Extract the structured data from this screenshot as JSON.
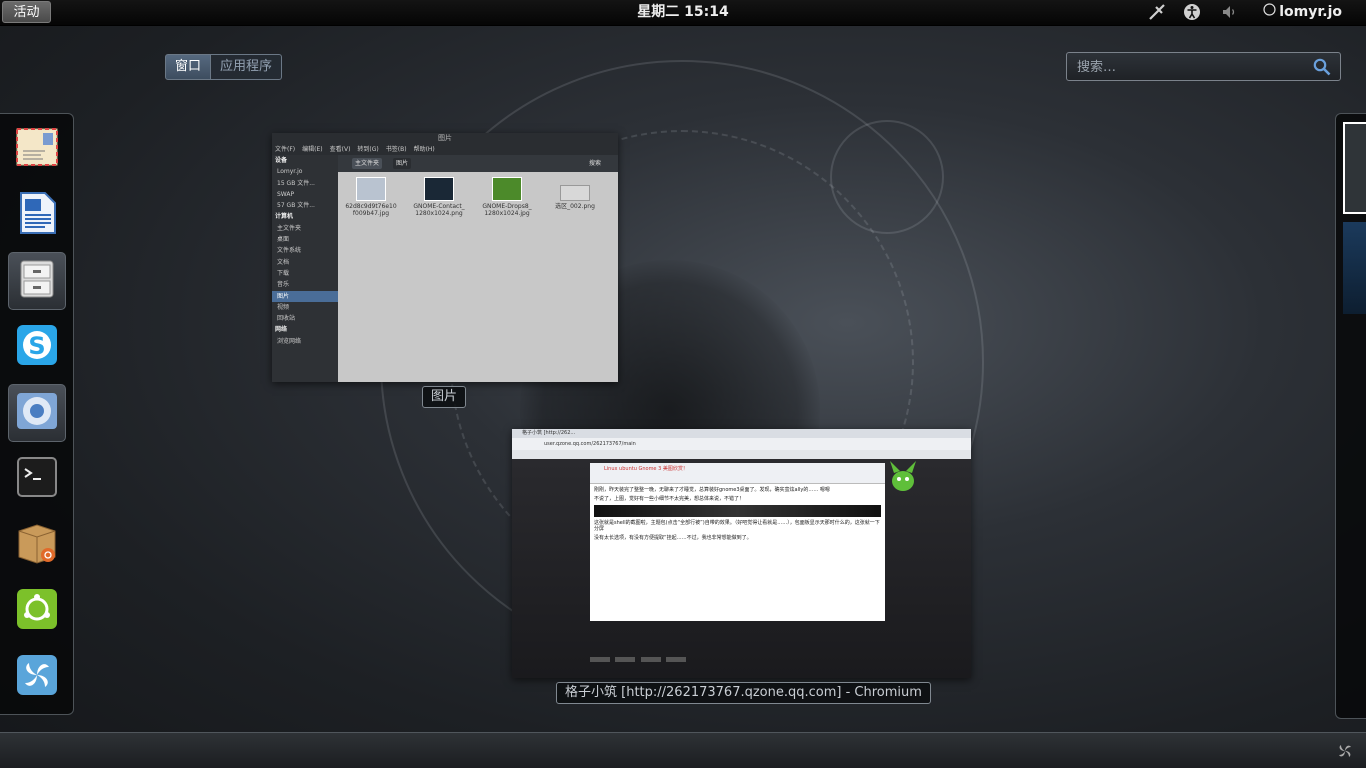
{
  "topbar": {
    "activities_label": "活动",
    "clock": "星期二 15:14",
    "user_name": "lomyr.jo"
  },
  "overview": {
    "view_tabs": [
      "窗口",
      "应用程序"
    ],
    "active_tab": "窗口",
    "search": {
      "placeholder": "搜索…",
      "value": ""
    }
  },
  "dash": {
    "apps": [
      {
        "name": "mail",
        "icon": "envelope-icon",
        "running": false
      },
      {
        "name": "writer",
        "icon": "document-icon",
        "running": false
      },
      {
        "name": "files",
        "icon": "file-cabinet-icon",
        "running": true
      },
      {
        "name": "skype",
        "icon": "skype-icon",
        "running": false
      },
      {
        "name": "chromium",
        "icon": "chromium-icon",
        "running": true
      },
      {
        "name": "terminal",
        "icon": "terminal-icon",
        "running": false
      },
      {
        "name": "package-installer",
        "icon": "package-icon",
        "running": false
      },
      {
        "name": "ubuntu-one",
        "icon": "ubuntu-icon",
        "running": false
      },
      {
        "name": "shotwell",
        "icon": "shotwell-icon",
        "running": false
      }
    ]
  },
  "windows": {
    "files": {
      "caption": "图片",
      "title": "图片",
      "menu": [
        "文件(F)",
        "编辑(E)",
        "查看(V)",
        "转到(G)",
        "书签(B)",
        "帮助(H)"
      ],
      "sidebar": {
        "devices_header": "设备",
        "devices": [
          "Lomyr.jo",
          "15 GB 文件...",
          "SWAP",
          "57 GB 文件..."
        ],
        "computer_header": "计算机",
        "places": [
          "主文件夹",
          "桌面",
          "文件系统",
          "文档",
          "下载",
          "音乐",
          "图片",
          "视频",
          "回收站"
        ],
        "network_header": "网络",
        "network": [
          "浏览网络"
        ]
      },
      "path": [
        "主文件夹",
        "图片"
      ],
      "search_label": "搜索",
      "files": [
        {
          "name": "62d8c9d9t76e10f009b47.jpg",
          "line1": "62d8c9d9t76e10",
          "line2": "f009b47.jpg",
          "color": "#b9c3d0"
        },
        {
          "name": "GNOME-Contact_1280x1024.png",
          "line1": "GNOME-Contact_",
          "line2": "1280x1024.png",
          "color": "#1a2836"
        },
        {
          "name": "GNOME-Drops8_1280x1024.jpg",
          "line1": "GNOME-Drops8_",
          "line2": "1280x1024.jpg",
          "color": "#4c8a2a"
        },
        {
          "name": "选区_002.png",
          "line1": "选区_002.png",
          "line2": "",
          "color": "#d8d8d8"
        }
      ]
    },
    "browser": {
      "caption": "格子小筑 [http://262173767.qzone.qq.com] - Chromium",
      "tab_title": "格子小筑 [http://262...",
      "url": "user.qzone.qq.com/262173767/main",
      "post_title": "Linux ubuntu Gnome 3 美图欣赏！",
      "text_lines": [
        "刚刚，昨天装完了整整一晚，无聊来了才睡觉，总算装好gnome3桌面了。发现，确实蛮炫ally的…… 嗯嗯",
        "不说了，上图，觉好有一些小细节不太完美，想总体来说，不错了！",
        "这张就是shell的截图啦，主题包(点击“全部行被”)自带的效果。（好吧觉得让看就是……），包面板显示天那时什么的，这张就一下分屏",
        "没有太长选项，有没有方便提取“挂起……不过，我也非常想能做到了。"
      ],
      "buttons": [
        "发表日志",
        "保存草稿",
        "预览",
        "取消"
      ]
    }
  }
}
